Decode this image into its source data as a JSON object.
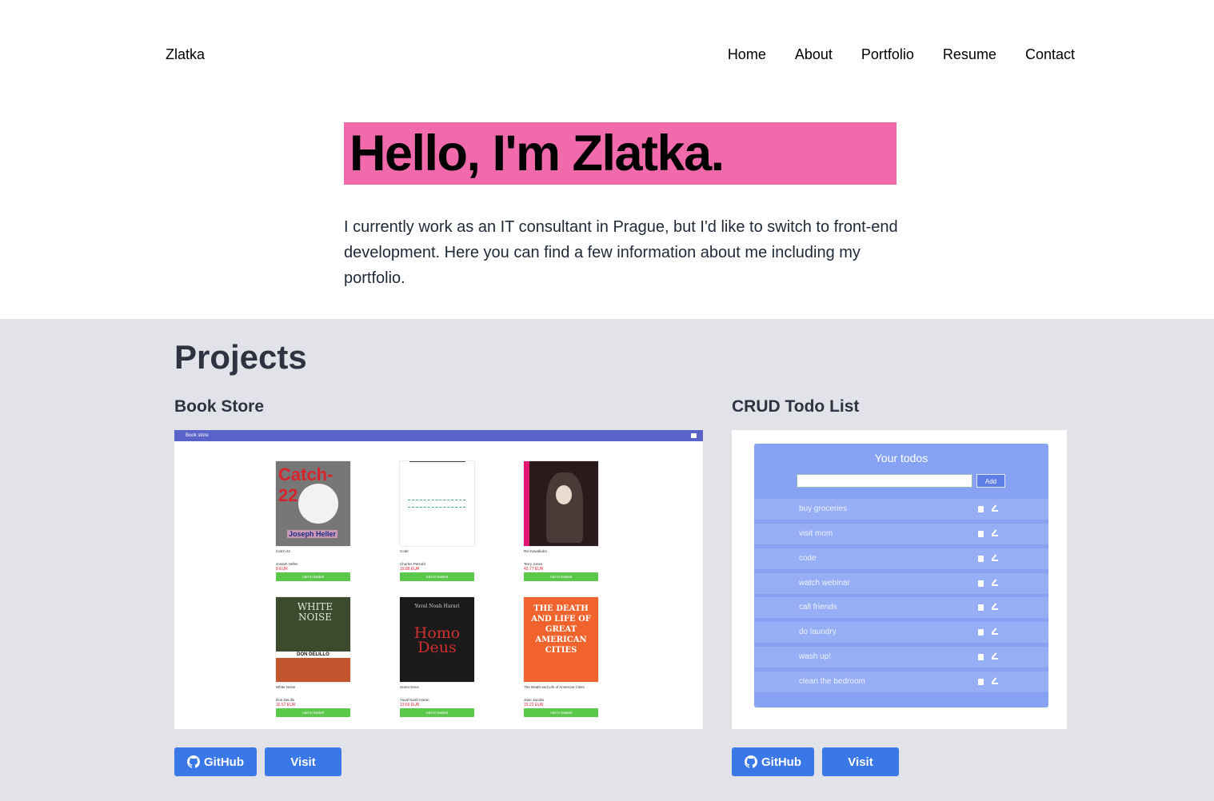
{
  "nav": {
    "brand": "Zlatka",
    "links": [
      "Home",
      "About",
      "Portfolio",
      "Resume",
      "Contact"
    ]
  },
  "hero": {
    "title": "Hello, I'm Zlatka.",
    "text": "I currently work as an IT consultant in Prague, but I'd like to switch to front-end development. Here you can find a few information about me including my portfolio."
  },
  "projects": {
    "heading": "Projects",
    "items": [
      {
        "name": "Book Store",
        "github_label": "GitHub",
        "visit_label": "Visit",
        "preview": {
          "app_title": "Book store",
          "add_label": "Add to basket",
          "books": [
            {
              "title": "Catch 22",
              "author": "Joseph Heller",
              "price": "8 EUR",
              "cover": "#6b6b6b",
              "cover_text": "Catch-22"
            },
            {
              "title": "Code",
              "author": "Charles Petzold",
              "price": "19.88 EUR",
              "cover": "#ffffff",
              "cover_text": ""
            },
            {
              "title": "Rei Kawakubo",
              "author": "Terry Jones",
              "price": "43.77 EUR",
              "cover": "#2a1a1c",
              "cover_text": ""
            },
            {
              "title": "White Noise",
              "author": "Don DeLillo",
              "price": "16.57 EUR",
              "cover": "#3c4a2e",
              "cover_text": "WHITE NOISE"
            },
            {
              "title": "Homo Deus",
              "author": "Yuval Noah Harari",
              "price": "13.69 EUR",
              "cover": "#1a1a1a",
              "cover_text": "Homo Deus"
            },
            {
              "title": "The Death and Life of American Cities",
              "author": "Jane Jacobs",
              "price": "15.22 EUR",
              "cover": "#f0632d",
              "cover_text": "THE DEATH AND LIFE OF GREAT AMERICAN CITIES"
            }
          ]
        }
      },
      {
        "name": "CRUD Todo List",
        "github_label": "GitHub",
        "visit_label": "Visit",
        "preview": {
          "title": "Your todos",
          "add_label": "Add",
          "todos": [
            "buy groceries",
            "visit mom",
            "code",
            "watch webinar",
            "call friends",
            "do laundry",
            "wash up!",
            "clean the bedroom"
          ]
        }
      }
    ]
  },
  "colors": {
    "hero_highlight": "#f06aac",
    "projects_bg": "#e1e3e8",
    "button": "#3b78e7",
    "bookstore_bar": "#5a64c8",
    "todo_panel": "#87a2f3"
  }
}
